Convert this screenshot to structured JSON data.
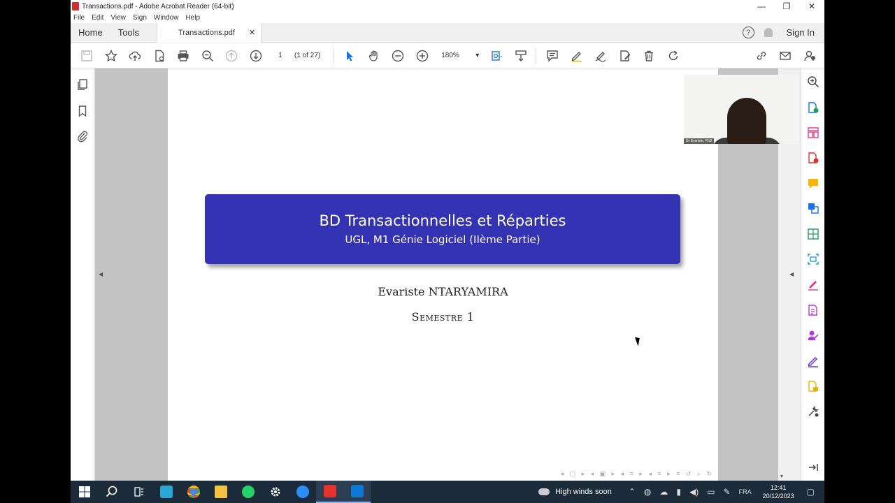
{
  "window": {
    "title": "Transactions.pdf - Adobe Acrobat Reader (64-bit)",
    "controls": [
      "—",
      "❐",
      "✕"
    ]
  },
  "menu": [
    "File",
    "Edit",
    "View",
    "Sign",
    "Window",
    "Help"
  ],
  "tabs": {
    "home": "Home",
    "tools": "Tools",
    "document": "Transactions.pdf",
    "close": "✕",
    "help": "?",
    "sign_in": "Sign In"
  },
  "toolbar": {
    "page_number": "1",
    "page_of": "(1 of 27)",
    "zoom": "180%",
    "zoom_arrow": "▾"
  },
  "document": {
    "title": "BD Transactionnelles et Réparties",
    "subtitle": "UGL, M1 Génie Logiciel (IIème Partie)",
    "author": "Evariste NTARYAMIRA",
    "semester": "Semestre 1",
    "accent_color": "#3333b3"
  },
  "webcam": {
    "name": "Dr Evariste, PhD"
  },
  "taskbar": {
    "weather": "High winds soon",
    "language": "FRA",
    "time": "12:41",
    "date": "20/12/2023"
  }
}
